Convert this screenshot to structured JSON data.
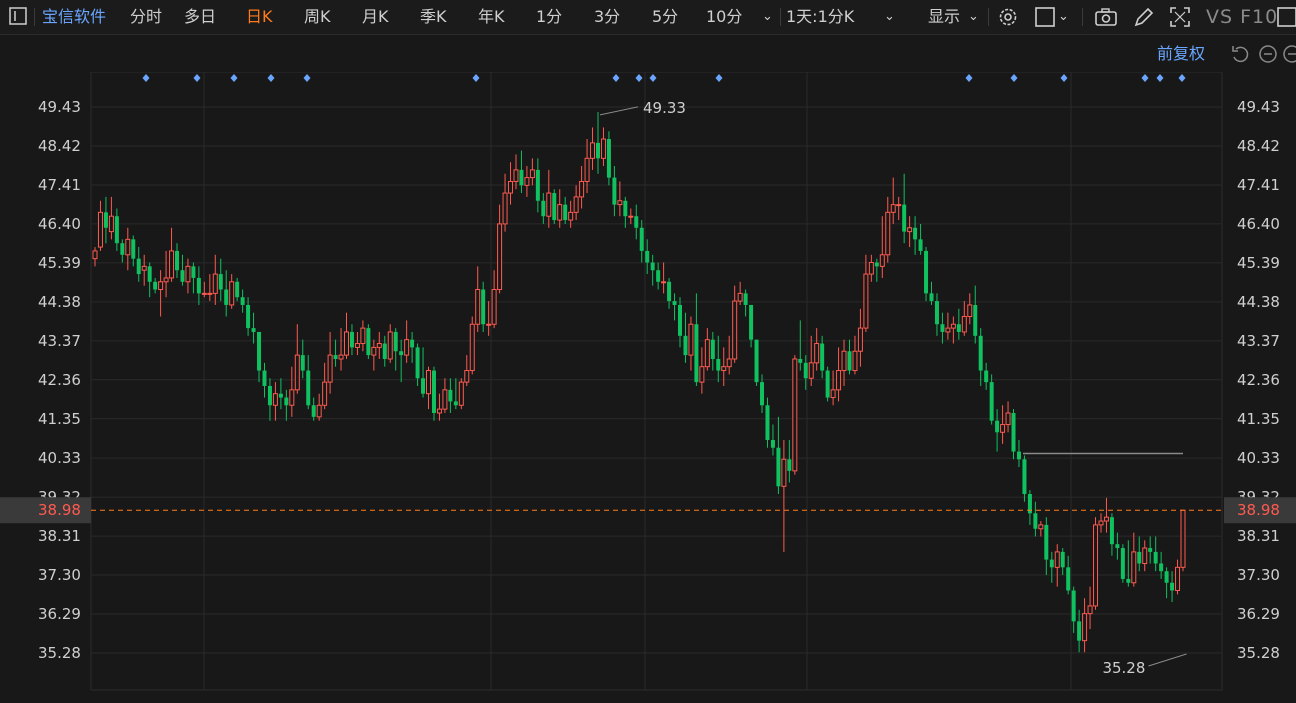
{
  "toolbar": {
    "menu_icon": "panel-icon",
    "brand": "宝信软件",
    "periods": [
      "分时",
      "多日",
      "日K",
      "周K",
      "月K",
      "季K",
      "年K",
      "1分",
      "3分",
      "5分",
      "10分"
    ],
    "active_period": "日K",
    "combo": "1天:1分K",
    "display": "显示",
    "right_text": "VS F10"
  },
  "subbar": {
    "adjust": "前复权"
  },
  "colors": {
    "up": "#ff5a4f",
    "down": "#10c160",
    "accent": "#ff7a1a",
    "brand": "#6aa6ff"
  },
  "price_axis": {
    "ticks": [
      "49.43",
      "48.42",
      "47.41",
      "46.40",
      "45.39",
      "44.38",
      "43.37",
      "42.36",
      "41.35",
      "40.33",
      "39.32",
      "38.31",
      "37.30",
      "36.29",
      "35.28"
    ],
    "current": "38.98",
    "high_label": "49.33",
    "low_label": "35.28"
  },
  "chart_data": {
    "type": "candlestick",
    "ylim": [
      34.6,
      50.7
    ],
    "current_price": 38.98,
    "high": 49.33,
    "low": 35.28,
    "candles": [
      [
        45.5,
        45.7,
        45.3,
        45.8
      ],
      [
        45.8,
        46.7,
        45.7,
        47.0
      ],
      [
        46.7,
        46.3,
        45.9,
        47.1
      ],
      [
        46.2,
        46.6,
        46.0,
        47.1
      ],
      [
        46.6,
        45.9,
        45.7,
        46.8
      ],
      [
        45.9,
        45.6,
        45.4,
        46.0
      ],
      [
        45.6,
        46.0,
        45.2,
        46.3
      ],
      [
        46.0,
        45.5,
        45.3,
        46.1
      ],
      [
        45.5,
        45.1,
        44.9,
        45.8
      ],
      [
        45.2,
        45.3,
        44.8,
        45.6
      ],
      [
        45.3,
        44.9,
        44.5,
        45.4
      ],
      [
        44.9,
        44.7,
        44.6,
        45.0
      ],
      [
        44.7,
        44.9,
        44.0,
        45.2
      ],
      [
        44.9,
        45.0,
        44.5,
        45.7
      ],
      [
        45.0,
        45.7,
        44.9,
        46.3
      ],
      [
        45.7,
        45.2,
        45.0,
        45.9
      ],
      [
        45.2,
        44.9,
        44.8,
        45.6
      ],
      [
        44.9,
        45.3,
        44.6,
        45.5
      ],
      [
        45.3,
        45.0,
        44.6,
        45.4
      ],
      [
        45.0,
        44.6,
        44.3,
        45.3
      ],
      [
        44.6,
        44.6,
        44.5,
        44.9
      ],
      [
        44.6,
        44.6,
        44.4,
        45.1
      ],
      [
        44.6,
        45.1,
        44.3,
        45.6
      ],
      [
        45.1,
        44.7,
        44.4,
        45.5
      ],
      [
        44.7,
        44.3,
        44.0,
        45.2
      ],
      [
        44.3,
        44.9,
        44.2,
        45.1
      ],
      [
        44.9,
        44.5,
        44.4,
        45.0
      ],
      [
        44.5,
        44.3,
        44.1,
        44.7
      ],
      [
        44.3,
        43.7,
        43.5,
        44.5
      ],
      [
        43.7,
        43.6,
        43.3,
        44.1
      ],
      [
        43.6,
        42.6,
        42.3,
        43.6
      ],
      [
        42.6,
        42.2,
        41.9,
        42.8
      ],
      [
        42.2,
        41.7,
        41.3,
        42.4
      ],
      [
        41.7,
        42.0,
        41.3,
        42.3
      ],
      [
        42.0,
        41.9,
        41.6,
        42.4
      ],
      [
        41.9,
        41.7,
        41.3,
        42.1
      ],
      [
        41.7,
        42.1,
        41.4,
        42.7
      ],
      [
        42.1,
        43.0,
        42.0,
        43.8
      ],
      [
        43.0,
        42.6,
        42.4,
        43.4
      ],
      [
        42.6,
        41.7,
        41.6,
        43.0
      ],
      [
        41.7,
        41.4,
        41.3,
        41.9
      ],
      [
        41.4,
        41.7,
        41.3,
        42.0
      ],
      [
        41.7,
        42.3,
        41.6,
        42.8
      ],
      [
        42.3,
        43.0,
        42.0,
        43.6
      ],
      [
        43.0,
        42.9,
        42.7,
        43.4
      ],
      [
        42.9,
        43.0,
        42.6,
        43.7
      ],
      [
        43.0,
        43.6,
        42.9,
        44.1
      ],
      [
        43.6,
        43.2,
        43.0,
        43.8
      ],
      [
        43.2,
        43.3,
        43.0,
        43.6
      ],
      [
        43.3,
        43.7,
        43.1,
        43.9
      ],
      [
        43.7,
        43.0,
        42.9,
        43.8
      ],
      [
        43.0,
        43.2,
        42.6,
        43.4
      ],
      [
        43.2,
        43.3,
        42.9,
        43.6
      ],
      [
        43.3,
        42.9,
        42.7,
        43.5
      ],
      [
        42.9,
        43.6,
        42.8,
        43.8
      ],
      [
        43.6,
        43.1,
        42.6,
        43.7
      ],
      [
        43.1,
        43.0,
        42.3,
        43.4
      ],
      [
        43.0,
        43.4,
        42.8,
        43.9
      ],
      [
        43.4,
        43.2,
        42.8,
        43.6
      ],
      [
        43.2,
        42.4,
        42.2,
        43.3
      ],
      [
        42.4,
        42.0,
        41.9,
        43.2
      ],
      [
        42.0,
        42.6,
        41.6,
        42.7
      ],
      [
        42.6,
        41.5,
        41.3,
        42.7
      ],
      [
        41.5,
        41.6,
        41.3,
        42.0
      ],
      [
        41.6,
        42.1,
        41.5,
        42.4
      ],
      [
        42.1,
        41.8,
        41.5,
        42.4
      ],
      [
        41.8,
        41.7,
        41.6,
        42.4
      ],
      [
        41.7,
        42.3,
        41.6,
        42.4
      ],
      [
        42.3,
        42.6,
        42.2,
        43.0
      ],
      [
        42.6,
        43.8,
        42.5,
        44.0
      ],
      [
        43.8,
        44.7,
        43.6,
        45.3
      ],
      [
        44.7,
        43.8,
        43.6,
        44.9
      ],
      [
        43.8,
        43.8,
        43.5,
        44.4
      ],
      [
        43.8,
        44.7,
        43.7,
        45.2
      ],
      [
        44.7,
        46.4,
        44.6,
        46.9
      ],
      [
        46.4,
        47.2,
        46.2,
        47.7
      ],
      [
        47.2,
        47.5,
        46.9,
        48.0
      ],
      [
        47.5,
        47.8,
        47.3,
        48.2
      ],
      [
        47.8,
        47.4,
        47.2,
        48.3
      ],
      [
        47.4,
        47.6,
        47.1,
        47.9
      ],
      [
        47.6,
        47.8,
        47.4,
        48.1
      ],
      [
        47.8,
        47.0,
        46.7,
        48.1
      ],
      [
        47.0,
        46.6,
        46.4,
        47.2
      ],
      [
        46.6,
        47.2,
        46.3,
        47.8
      ],
      [
        47.2,
        46.5,
        46.4,
        47.3
      ],
      [
        46.5,
        46.9,
        46.3,
        47.3
      ],
      [
        46.9,
        46.5,
        46.4,
        47.1
      ],
      [
        46.5,
        46.7,
        46.3,
        47.0
      ],
      [
        46.7,
        47.1,
        46.5,
        47.4
      ],
      [
        47.1,
        47.5,
        46.8,
        47.9
      ],
      [
        47.5,
        48.1,
        47.2,
        48.6
      ],
      [
        48.1,
        48.5,
        47.8,
        48.9
      ],
      [
        48.5,
        48.1,
        47.7,
        49.3
      ],
      [
        48.1,
        48.6,
        47.9,
        48.9
      ],
      [
        48.6,
        47.6,
        47.4,
        48.8
      ],
      [
        47.6,
        46.9,
        46.6,
        47.9
      ],
      [
        46.9,
        47.0,
        46.6,
        47.5
      ],
      [
        47.0,
        46.6,
        46.3,
        47.1
      ],
      [
        46.6,
        46.6,
        46.4,
        46.8
      ],
      [
        46.6,
        46.3,
        46.0,
        46.9
      ],
      [
        46.3,
        45.7,
        45.4,
        46.5
      ],
      [
        45.7,
        45.4,
        45.1,
        46.0
      ],
      [
        45.4,
        45.2,
        44.8,
        45.6
      ],
      [
        45.2,
        44.9,
        44.7,
        45.4
      ],
      [
        44.9,
        44.9,
        44.6,
        45.4
      ],
      [
        44.9,
        44.4,
        44.2,
        45.0
      ],
      [
        44.4,
        44.3,
        43.9,
        44.6
      ],
      [
        44.3,
        43.5,
        43.2,
        44.5
      ],
      [
        43.5,
        43.0,
        42.8,
        44.1
      ],
      [
        43.0,
        43.8,
        42.6,
        44.0
      ],
      [
        43.8,
        42.3,
        42.2,
        44.6
      ],
      [
        42.3,
        42.7,
        42.0,
        43.2
      ],
      [
        42.7,
        43.4,
        42.6,
        43.7
      ],
      [
        43.4,
        42.9,
        42.6,
        43.6
      ],
      [
        42.9,
        42.6,
        42.3,
        43.5
      ],
      [
        42.6,
        42.7,
        42.2,
        43.2
      ],
      [
        42.7,
        42.9,
        42.5,
        43.5
      ],
      [
        42.9,
        44.4,
        42.8,
        44.8
      ],
      [
        44.4,
        44.6,
        44.3,
        44.9
      ],
      [
        44.6,
        44.3,
        44.0,
        44.7
      ],
      [
        44.3,
        43.4,
        43.2,
        44.3
      ],
      [
        43.4,
        42.3,
        42.2,
        43.4
      ],
      [
        42.3,
        41.7,
        41.5,
        42.5
      ],
      [
        41.7,
        40.8,
        40.6,
        41.9
      ],
      [
        40.8,
        40.6,
        40.4,
        41.2
      ],
      [
        40.6,
        39.6,
        39.4,
        41.4
      ],
      [
        39.6,
        40.3,
        37.9,
        40.8
      ],
      [
        40.3,
        40.0,
        39.7,
        40.8
      ],
      [
        40.0,
        42.9,
        39.9,
        43.0
      ],
      [
        42.9,
        42.8,
        42.6,
        43.9
      ],
      [
        42.8,
        42.4,
        42.1,
        43.0
      ],
      [
        42.4,
        42.8,
        42.2,
        43.5
      ],
      [
        42.8,
        43.3,
        42.6,
        43.7
      ],
      [
        43.3,
        42.6,
        42.4,
        43.5
      ],
      [
        42.6,
        41.9,
        41.8,
        42.7
      ],
      [
        41.9,
        42.1,
        41.7,
        42.6
      ],
      [
        42.1,
        42.6,
        41.8,
        43.2
      ],
      [
        42.6,
        43.1,
        42.2,
        43.4
      ],
      [
        43.1,
        42.6,
        42.5,
        43.4
      ],
      [
        42.6,
        43.1,
        42.5,
        43.5
      ],
      [
        43.1,
        43.7,
        42.7,
        44.2
      ],
      [
        43.7,
        45.1,
        43.6,
        45.6
      ],
      [
        45.1,
        45.4,
        44.9,
        45.6
      ],
      [
        45.4,
        45.3,
        44.9,
        45.5
      ],
      [
        45.3,
        45.6,
        45.0,
        46.6
      ],
      [
        45.6,
        46.7,
        45.4,
        47.1
      ],
      [
        46.7,
        46.9,
        46.4,
        47.6
      ],
      [
        46.9,
        46.9,
        46.5,
        47.1
      ],
      [
        46.9,
        46.2,
        45.9,
        47.7
      ],
      [
        46.2,
        46.3,
        45.8,
        46.6
      ],
      [
        46.3,
        46.0,
        45.6,
        46.6
      ],
      [
        46.0,
        45.7,
        45.6,
        46.4
      ],
      [
        45.7,
        44.6,
        44.4,
        45.8
      ],
      [
        44.6,
        44.4,
        44.3,
        44.9
      ],
      [
        44.4,
        43.8,
        43.5,
        44.6
      ],
      [
        43.8,
        43.6,
        43.3,
        44.1
      ],
      [
        43.6,
        43.7,
        43.4,
        44.1
      ],
      [
        43.7,
        43.8,
        43.3,
        44.0
      ],
      [
        43.8,
        43.6,
        43.4,
        44.2
      ],
      [
        43.6,
        44.0,
        43.5,
        44.4
      ],
      [
        44.0,
        44.3,
        43.8,
        44.6
      ],
      [
        44.3,
        43.5,
        43.3,
        44.8
      ],
      [
        43.5,
        42.6,
        42.2,
        43.7
      ],
      [
        42.6,
        42.3,
        42.1,
        42.8
      ],
      [
        42.3,
        41.3,
        41.2,
        42.5
      ],
      [
        41.3,
        41.0,
        40.5,
        41.6
      ],
      [
        41.0,
        41.2,
        40.7,
        41.7
      ],
      [
        41.2,
        41.5,
        41.0,
        41.8
      ],
      [
        41.5,
        40.5,
        40.3,
        41.6
      ],
      [
        40.5,
        40.3,
        40.1,
        40.8
      ],
      [
        40.3,
        39.4,
        39.2,
        40.4
      ],
      [
        39.4,
        38.9,
        38.6,
        39.5
      ],
      [
        38.9,
        38.5,
        38.3,
        39.2
      ],
      [
        38.5,
        38.6,
        38.3,
        38.7
      ],
      [
        38.6,
        37.7,
        37.3,
        38.8
      ],
      [
        37.7,
        37.5,
        37.1,
        37.9
      ],
      [
        37.5,
        37.9,
        37.0,
        38.1
      ],
      [
        37.9,
        37.5,
        37.3,
        38.0
      ],
      [
        37.5,
        36.9,
        36.8,
        37.8
      ],
      [
        36.9,
        36.1,
        35.8,
        37.0
      ],
      [
        36.1,
        35.6,
        35.3,
        36.4
      ],
      [
        35.6,
        36.3,
        35.3,
        36.7
      ],
      [
        36.3,
        36.5,
        35.9,
        37.0
      ],
      [
        36.5,
        38.6,
        36.4,
        38.8
      ],
      [
        38.6,
        38.7,
        38.4,
        38.9
      ],
      [
        38.7,
        38.8,
        38.4,
        39.3
      ],
      [
        38.8,
        38.1,
        37.8,
        38.9
      ],
      [
        38.1,
        38.0,
        37.7,
        38.4
      ],
      [
        38.0,
        37.2,
        37.1,
        38.1
      ],
      [
        37.2,
        37.1,
        37.0,
        38.2
      ],
      [
        37.1,
        37.9,
        37.0,
        38.4
      ],
      [
        37.9,
        37.6,
        37.4,
        38.3
      ],
      [
        37.6,
        38.0,
        37.4,
        38.2
      ],
      [
        38.0,
        37.9,
        37.6,
        38.3
      ],
      [
        37.9,
        37.6,
        37.4,
        38.3
      ],
      [
        37.6,
        37.4,
        37.2,
        37.9
      ],
      [
        37.4,
        37.1,
        36.7,
        37.5
      ],
      [
        37.1,
        36.9,
        36.6,
        37.4
      ],
      [
        36.9,
        37.5,
        36.8,
        37.7
      ],
      [
        37.5,
        38.98,
        37.4,
        38.98
      ]
    ],
    "markers": [
      146,
      197,
      234,
      271,
      307,
      476,
      616,
      639,
      653,
      719,
      969,
      1014,
      1064,
      1145,
      1160,
      1182
    ]
  }
}
